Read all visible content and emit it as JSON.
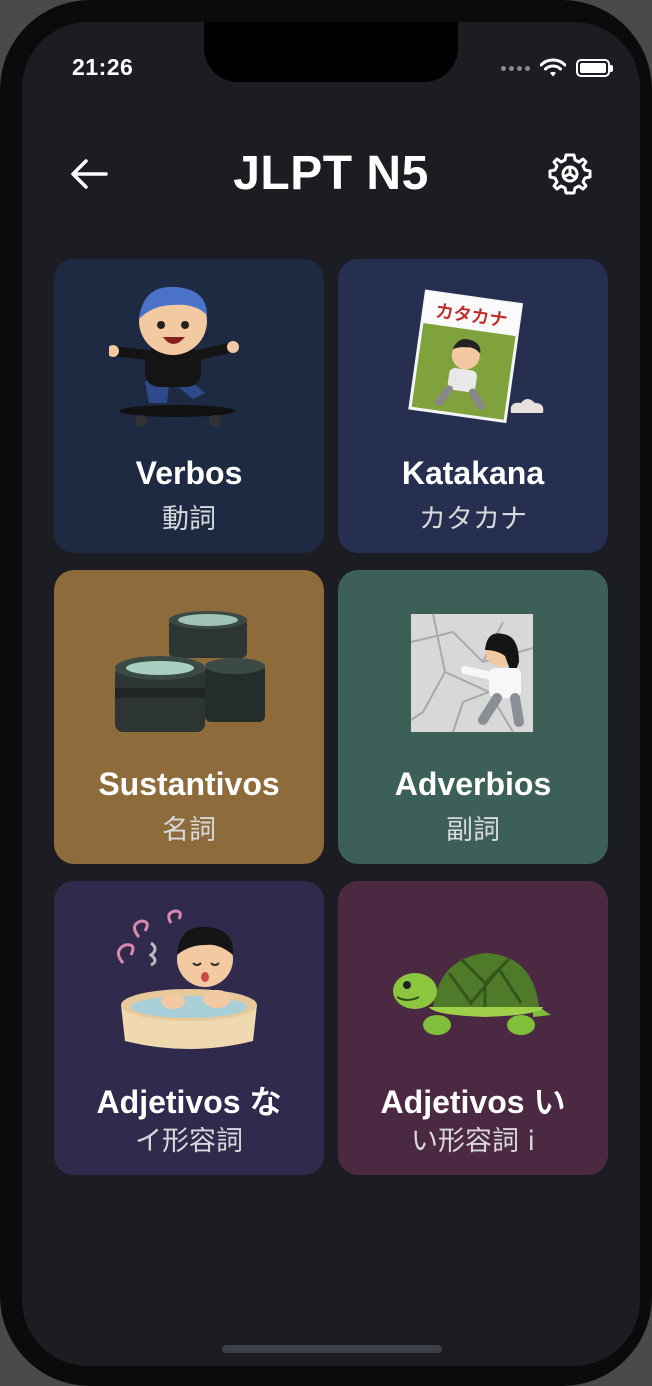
{
  "status_bar": {
    "time": "21:26"
  },
  "header": {
    "title": "JLPT N5"
  },
  "colors": {
    "background": "#1b1d23",
    "card_verbos": "#1e2a42",
    "card_katakana": "#262f50",
    "card_sustantivos": "#8d6b3a",
    "card_adverbios": "#3c5f58",
    "card_adjetivos_na": "#302b4d",
    "card_adjetivos_i": "#4b2942"
  },
  "categories": [
    {
      "title": "Verbos",
      "subtitle": "動詞",
      "icon": "skateboarder-icon"
    },
    {
      "title": "Katakana",
      "subtitle": "カタカナ",
      "icon": "katakana-book-icon"
    },
    {
      "title": "Sustantivos",
      "subtitle": "名詞",
      "icon": "camera-lenses-icon"
    },
    {
      "title": "Adverbios",
      "subtitle": "副詞",
      "icon": "escaping-wall-icon"
    },
    {
      "title": "Adjetivos な",
      "subtitle": "イ形容詞",
      "icon": "hot-bath-icon"
    },
    {
      "title": "Adjetivos い",
      "subtitle": "い形容詞 i",
      "icon": "turtle-icon"
    }
  ],
  "illustration_text": {
    "book_cover": "カタカナ"
  }
}
